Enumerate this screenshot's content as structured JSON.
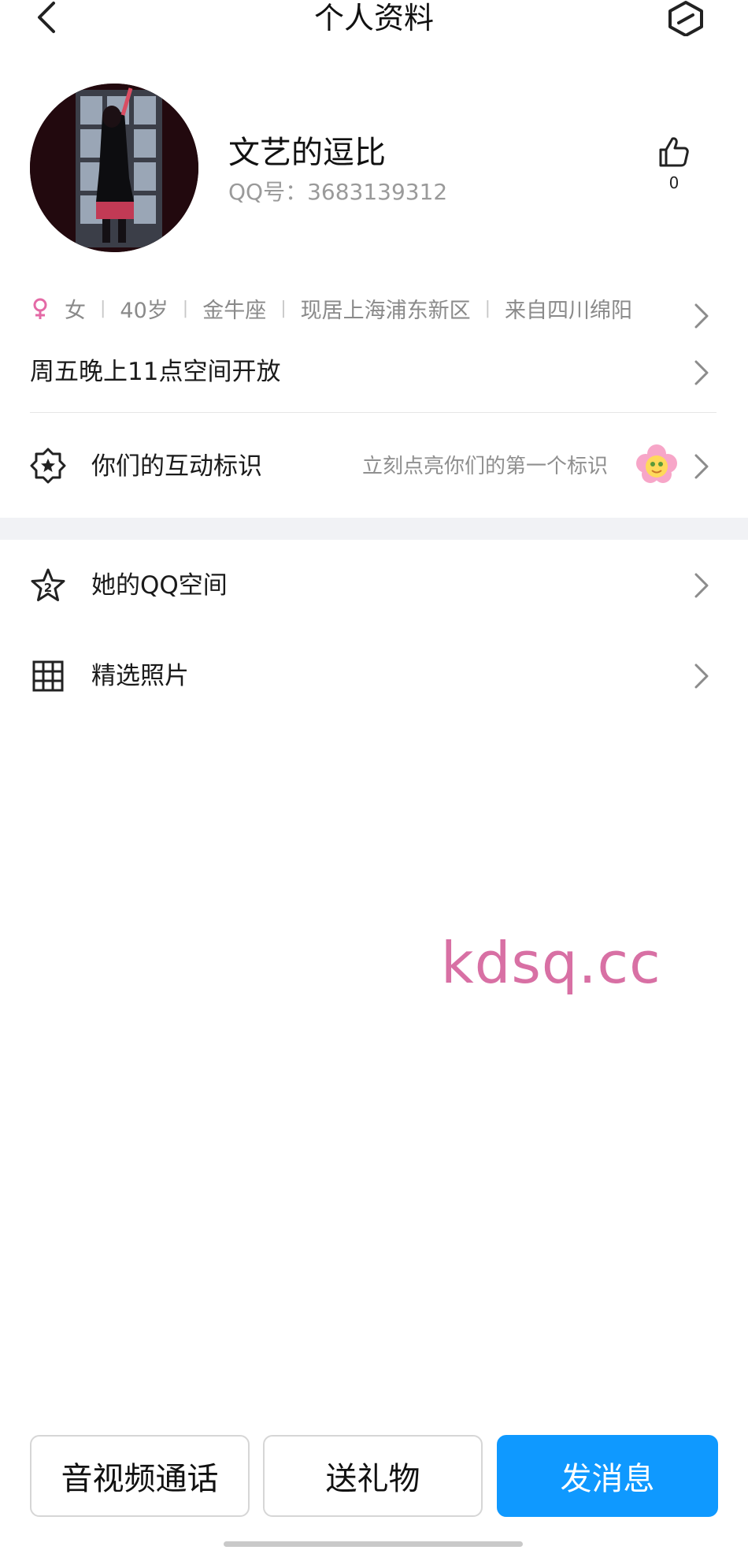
{
  "header": {
    "title": "个人资料",
    "back_icon": "chevron-left-icon",
    "settings_icon": "hexagon-slash-icon"
  },
  "profile": {
    "nickname": "文艺的逗比",
    "qq_label": "QQ号：",
    "qq_number": "3683139312",
    "like_count": "0",
    "gender": "女",
    "age": "40岁",
    "zodiac": "金牛座",
    "residence": "现居上海浦东新区",
    "hometown": "来自四川绵阳",
    "signature": "周五晚上11点空间开放",
    "gender_color": "#e46aa6"
  },
  "interaction": {
    "label": "你们的互动标识",
    "hint": "立刻点亮你们的第一个标识"
  },
  "menu": [
    {
      "label": "她的QQ空间",
      "icon": "star-2-icon"
    },
    {
      "label": "精选照片",
      "icon": "grid-icon"
    }
  ],
  "watermark": "kdsq.cc",
  "actions": {
    "call": "音视频通话",
    "gift": "送礼物",
    "message": "发消息"
  },
  "colors": {
    "accent": "#0f99ff",
    "watermark": "#d870a4"
  }
}
